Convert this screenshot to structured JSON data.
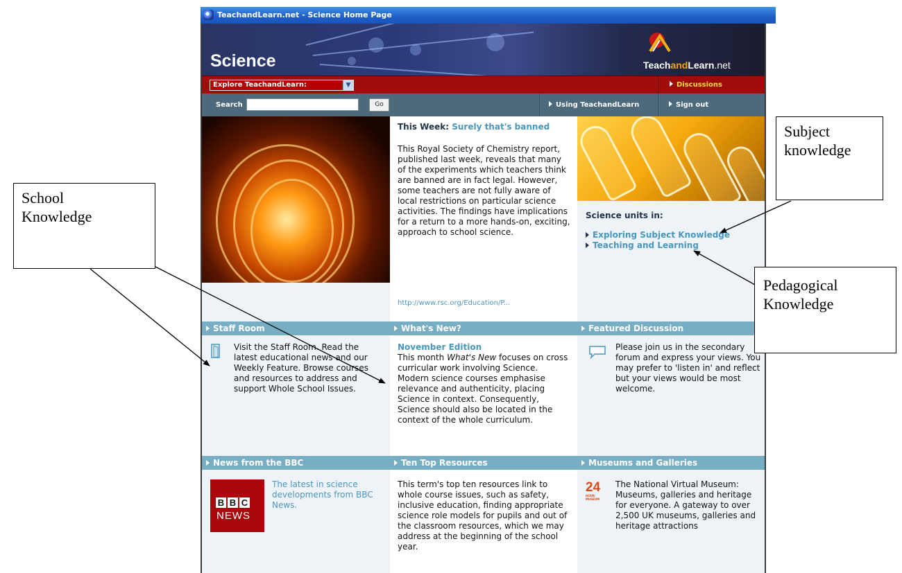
{
  "window": {
    "title": "TeachandLearn.net - Science Home Page"
  },
  "header": {
    "site_title": "Science",
    "logo_teach": "Teach",
    "logo_and": "and",
    "logo_learn": "Learn",
    "logo_net": ".net"
  },
  "nav": {
    "explore_label": "Explore TeachandLearn:",
    "discussions": "Discussions",
    "search_label": "Search",
    "search_value": "",
    "go_label": "Go",
    "using": "Using TeachandLearn",
    "sign_out": "Sign out"
  },
  "this_week": {
    "prefix": "This Week: ",
    "title": "Surely that's banned",
    "body": "This Royal Society of Chemistry report, published last week, reveals that many of the experiments which teachers think are banned are in fact legal. However, some teachers are not fully aware of local restrictions on particular science activities. The findings have implications for a return to a more hands-on, exciting, approach to school science.",
    "url": "http://www.rsc.org/Education/P..."
  },
  "science_units": {
    "heading": "Science units in:",
    "items": [
      "Exploring Subject Knowledge",
      "Teaching and Learning"
    ]
  },
  "staff_room": {
    "header": "Staff Room",
    "body": "Visit the Staff Room. Read the latest educational news and our Weekly Feature. Browse courses and resources to address and support Whole School Issues."
  },
  "whats_new": {
    "header": "What's New?",
    "edition": "November Edition",
    "body_pre": "This month ",
    "body_em": "What's New",
    "body_post": " focuses on cross curricular work involving Science. Modern science courses emphasise relevance and authenticity, placing Science in context. Consequently, Science should also be located in the context of the whole curriculum."
  },
  "featured_discussion": {
    "header": "Featured Discussion",
    "body": "Please join us in the secondary forum and express your views. You may prefer to 'listen in' and reflect but your views would be most welcome."
  },
  "bbc": {
    "header": "News from the BBC",
    "body": "The latest in science developments from BBC News.",
    "logo_letters": [
      "B",
      "B",
      "C"
    ],
    "logo_news": "NEWS"
  },
  "top_resources": {
    "header": "Ten Top Resources",
    "body": "This term's top ten resources link to whole course issues, such as safety, inclusive education, finding appropriate science role models for pupils and out of the classroom resources, which we may address at the beginning of the school year."
  },
  "museums": {
    "header": "Museums and Galleries",
    "body": "The National Virtual Museum: Museums, galleries and heritage for everyone. A gateway to over 2,500 UK museums, galleries and heritage attractions",
    "logo_number": "24",
    "logo_caption": "HOUR MUSEUM"
  },
  "annotations": {
    "subject_line1": "Subject",
    "subject_line2": "knowledge",
    "school_line1": "School",
    "school_line2": "Knowledge",
    "pedagogical_line1": "Pedagogical",
    "pedagogical_line2": "Knowledge"
  },
  "colors": {
    "section_header": "#78aec3",
    "link": "#4a96bd",
    "red_bar": "#a00c0c",
    "search_bar": "#4d6a7c"
  }
}
